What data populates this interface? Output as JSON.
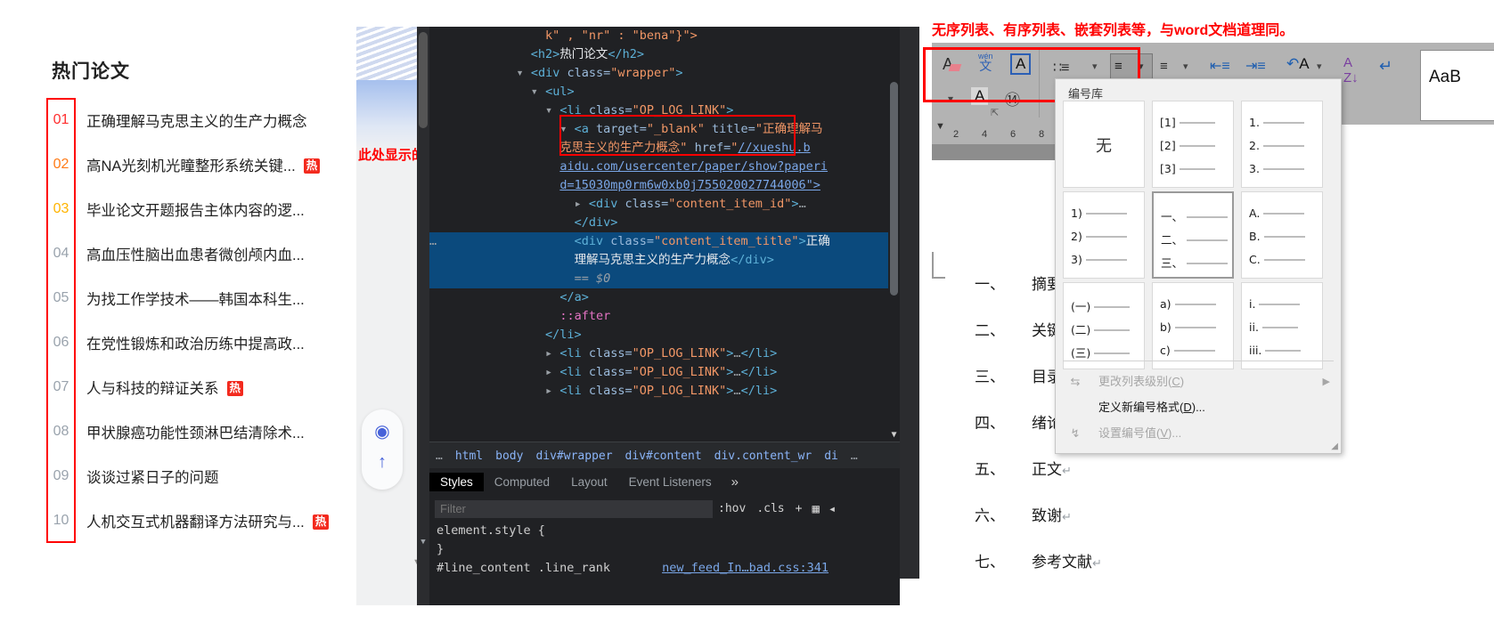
{
  "left_panel": {
    "heading": "热门论文",
    "papers": [
      {
        "rank": "01",
        "title": "正确理解马克思主义的生产力概念",
        "hot": false
      },
      {
        "rank": "02",
        "title": "高NA光刻机光瞳整形系统关键...",
        "hot": true
      },
      {
        "rank": "03",
        "title": "毕业论文开题报告主体内容的逻...",
        "hot": false
      },
      {
        "rank": "04",
        "title": "高血压性脑出血患者微创颅内血...",
        "hot": false
      },
      {
        "rank": "05",
        "title": "为找工作学技术——韩国本科生...",
        "hot": false
      },
      {
        "rank": "06",
        "title": "在党性锻炼和政治历练中提高政...",
        "hot": false
      },
      {
        "rank": "07",
        "title": "人与科技的辩证关系",
        "hot": true
      },
      {
        "rank": "08",
        "title": "甲状腺癌功能性颈淋巴结清除术...",
        "hot": false
      },
      {
        "rank": "09",
        "title": "谈谈过紧日子的问题",
        "hot": false
      },
      {
        "rank": "10",
        "title": "人机交互式机器翻译方法研究与...",
        "hot": true
      }
    ],
    "hot_badge": "热",
    "colors": {
      "rank1": "#ff2d2d",
      "rank2": "#ff7b17",
      "rank3": "#ffb400",
      "rank_rest": "#9aa3ad",
      "hot_badge_bg": "#f32a1e",
      "annotation_red": "#ff0000"
    }
  },
  "browser": {
    "annotation": "此处显示的就是列表标签。",
    "float_buttons": [
      {
        "icon": "globe-icon",
        "label": ""
      },
      {
        "icon": "arrow-up-icon",
        "label": ""
      }
    ]
  },
  "devtools": {
    "dom_lines": [
      {
        "indent": 7,
        "parts": [
          {
            "t": "k\" , \"nr\" : \"bena\"}\">",
            "c": "val"
          }
        ],
        "cut_top": true
      },
      {
        "indent": 6,
        "parts": [
          {
            "t": "<h2>",
            "c": "tag"
          },
          {
            "t": "热门论文",
            "c": "txt"
          },
          {
            "t": "</h2>",
            "c": "tag"
          }
        ]
      },
      {
        "indent": 5,
        "arrow": "down",
        "parts": [
          {
            "t": "<div ",
            "c": "tag"
          },
          {
            "t": "class=",
            "c": "attr"
          },
          {
            "t": "\"wrapper\"",
            "c": "val"
          },
          {
            "t": ">",
            "c": "tag"
          }
        ]
      },
      {
        "indent": 6,
        "arrow": "down",
        "parts": [
          {
            "t": "<ul>",
            "c": "tag"
          }
        ]
      },
      {
        "indent": 7,
        "arrow": "down",
        "parts": [
          {
            "t": "<li ",
            "c": "tag"
          },
          {
            "t": "class=",
            "c": "attr"
          },
          {
            "t": "\"OP_LOG_LINK\"",
            "c": "val"
          },
          {
            "t": ">",
            "c": "tag"
          }
        ]
      },
      {
        "indent": 8,
        "arrow": "down",
        "parts": [
          {
            "t": "<a ",
            "c": "tag"
          },
          {
            "t": "target=",
            "c": "attr"
          },
          {
            "t": "\"_blank\"",
            "c": "val"
          },
          {
            "t": " ",
            "c": "tag"
          },
          {
            "t": "title=",
            "c": "attr"
          },
          {
            "t": "\"正确理解马",
            "c": "val"
          }
        ]
      },
      {
        "indent": 8,
        "parts": [
          {
            "t": "克思主义的生产力概念\"",
            "c": "val"
          },
          {
            "t": " ",
            "c": "tag"
          },
          {
            "t": "href=",
            "c": "attr"
          },
          {
            "t": "\"",
            "c": "val"
          },
          {
            "t": "//xueshu.b",
            "c": "link"
          }
        ]
      },
      {
        "indent": 8,
        "parts": [
          {
            "t": "aidu.com/usercenter/paper/show?paperi",
            "c": "link"
          }
        ]
      },
      {
        "indent": 8,
        "parts": [
          {
            "t": "d=15030mp0rm6w0xb0j755020027744006\">",
            "c": "link"
          }
        ]
      },
      {
        "indent": 9,
        "arrow": "right",
        "parts": [
          {
            "t": "<div ",
            "c": "tag"
          },
          {
            "t": "class=",
            "c": "attr"
          },
          {
            "t": "\"content_item_id\"",
            "c": "val"
          },
          {
            "t": ">",
            "c": "tag"
          },
          {
            "t": "…",
            "c": "ellip"
          }
        ]
      },
      {
        "indent": 9,
        "parts": [
          {
            "t": "</div>",
            "c": "tag"
          }
        ]
      },
      {
        "indent": 9,
        "selected": true,
        "gutter": "…",
        "parts": [
          {
            "t": "<div ",
            "c": "tag"
          },
          {
            "t": "class=",
            "c": "attr"
          },
          {
            "t": "\"content_item_title\"",
            "c": "val"
          },
          {
            "t": ">",
            "c": "tag"
          },
          {
            "t": "正确",
            "c": "txt"
          }
        ]
      },
      {
        "indent": 9,
        "selected": true,
        "parts": [
          {
            "t": "理解马克思主义的生产力概念",
            "c": "txt"
          },
          {
            "t": "</div>",
            "c": "tag"
          }
        ]
      },
      {
        "indent": 9,
        "selected": true,
        "parts": [
          {
            "t": "== $0",
            "c": "dollar"
          }
        ]
      },
      {
        "indent": 8,
        "parts": [
          {
            "t": "</a>",
            "c": "tag"
          }
        ]
      },
      {
        "indent": 8,
        "parts": [
          {
            "t": "::after",
            "c": "pseudo"
          }
        ]
      },
      {
        "indent": 7,
        "parts": [
          {
            "t": "</li>",
            "c": "tag"
          }
        ]
      },
      {
        "indent": 7,
        "arrow": "right",
        "parts": [
          {
            "t": "<li ",
            "c": "tag"
          },
          {
            "t": "class=",
            "c": "attr"
          },
          {
            "t": "\"OP_LOG_LINK\"",
            "c": "val"
          },
          {
            "t": ">",
            "c": "tag"
          },
          {
            "t": "…",
            "c": "ellip"
          },
          {
            "t": "</li>",
            "c": "tag"
          }
        ]
      },
      {
        "indent": 7,
        "arrow": "right",
        "parts": [
          {
            "t": "<li ",
            "c": "tag"
          },
          {
            "t": "class=",
            "c": "attr"
          },
          {
            "t": "\"OP_LOG_LINK\"",
            "c": "val"
          },
          {
            "t": ">",
            "c": "tag"
          },
          {
            "t": "…",
            "c": "ellip"
          },
          {
            "t": "</li>",
            "c": "tag"
          }
        ]
      },
      {
        "indent": 7,
        "arrow": "right",
        "parts": [
          {
            "t": "<li ",
            "c": "tag"
          },
          {
            "t": "class=",
            "c": "attr"
          },
          {
            "t": "\"OP_LOG_LINK\"",
            "c": "val"
          },
          {
            "t": ">",
            "c": "tag"
          },
          {
            "t": "…",
            "c": "ellip"
          },
          {
            "t": "</li>",
            "c": "tag"
          }
        ]
      }
    ],
    "breadcrumb": [
      "…",
      "html",
      "body",
      "div#wrapper",
      "div#content",
      "div.content_wr",
      "di",
      "…"
    ],
    "panel_tabs": [
      "Styles",
      "Computed",
      "Layout",
      "Event Listeners"
    ],
    "panel_tabs_more": "»",
    "active_panel_tab": "Styles",
    "filter_placeholder": "Filter",
    "filter_value": "",
    "filter_toolbar": [
      ":hov",
      ".cls",
      "+",
      "📋",
      "◁"
    ],
    "styles": {
      "element_style_open": "element.style {",
      "element_style_close": "}",
      "rule_selector": "#line_content .line_rank",
      "rule_source": "new_feed_In…bad.css:341"
    }
  },
  "word": {
    "annotation": "无序列表、有序列表、嵌套列表等，与word文档道理同。",
    "ribbon_icons": [
      "clear-formatting-icon",
      "phonetic-guide-icon",
      "character-border-icon",
      "bullet-list-icon",
      "numbered-list-icon",
      "multilevel-list-icon",
      "decrease-indent-icon",
      "increase-indent-icon",
      "character-shading-icon",
      "sort-icon",
      "show-formatting-marks-icon"
    ],
    "style_gallery_label": "AaB",
    "ruler_ticks": [
      "2",
      "4",
      "6",
      "8"
    ],
    "document_lines": [
      {
        "num": "一、",
        "text": "摘要"
      },
      {
        "num": "二、",
        "text": "关键词"
      },
      {
        "num": "三、",
        "text": "目录"
      },
      {
        "num": "四、",
        "text": "绪论"
      },
      {
        "num": "五、",
        "text": "正文"
      },
      {
        "num": "六、",
        "text": "致谢"
      },
      {
        "num": "七、",
        "text": "参考文献"
      }
    ],
    "pilcrow": "↵",
    "numbering_dropdown": {
      "title": "编号库",
      "gallery": [
        {
          "id": "none",
          "kind": "none",
          "label": "无",
          "selected": false
        },
        {
          "id": "bracket",
          "kind": "lines",
          "lines": [
            "[1]",
            "[2]",
            "[3]"
          ],
          "selected": false
        },
        {
          "id": "arabic-dot",
          "kind": "lines",
          "lines": [
            "1.",
            "2.",
            "3."
          ],
          "selected": false
        },
        {
          "id": "arabic-paren",
          "kind": "lines",
          "lines": [
            "1)",
            "2)",
            "3)"
          ],
          "selected": false
        },
        {
          "id": "cjk-dun",
          "kind": "lines",
          "lines": [
            "一、",
            "二、",
            "三、"
          ],
          "selected": true
        },
        {
          "id": "upper-alpha",
          "kind": "lines",
          "lines": [
            "A.",
            "B.",
            "C."
          ],
          "selected": false
        },
        {
          "id": "cjk-paren",
          "kind": "lines",
          "lines": [
            "(一)",
            "(二)",
            "(三)"
          ],
          "selected": false
        },
        {
          "id": "lower-alpha-paren",
          "kind": "lines",
          "lines": [
            "a)",
            "b)",
            "c)"
          ],
          "selected": false
        },
        {
          "id": "lower-roman",
          "kind": "lines",
          "lines": [
            "i.",
            "ii.",
            "iii."
          ],
          "selected": false
        }
      ],
      "menu_items": [
        {
          "icon": "change-list-level-icon",
          "label": "更改列表级别(C)",
          "enabled": false,
          "submenu": "▶"
        },
        {
          "icon": "",
          "label": "定义新编号格式(D)...",
          "enabled": true,
          "submenu": ""
        },
        {
          "icon": "set-numbering-value-icon",
          "label": "设置编号值(V)...",
          "enabled": false,
          "submenu": ""
        }
      ]
    }
  }
}
